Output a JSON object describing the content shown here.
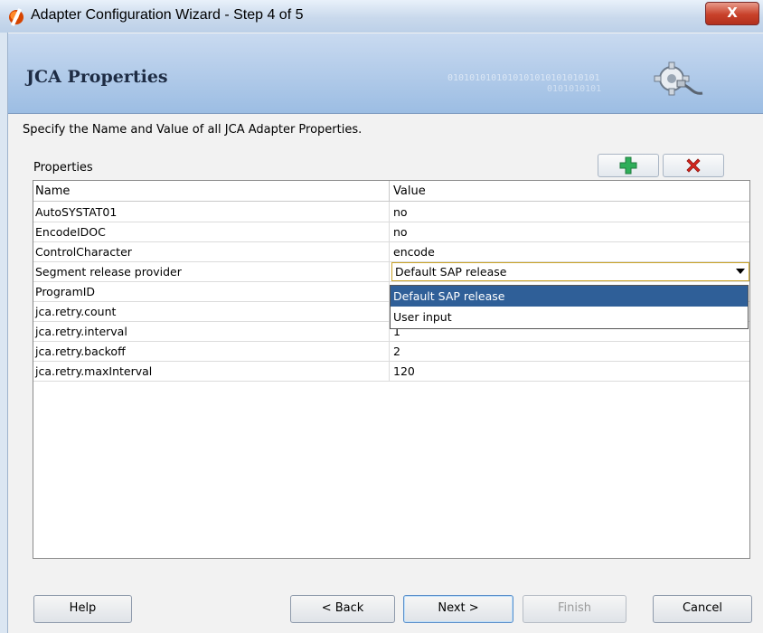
{
  "window": {
    "title": "Adapter Configuration Wizard - Step 4 of 5",
    "close_label": "X"
  },
  "header": {
    "title": "JCA Properties",
    "binary_line1": "0101010101010101010101010101",
    "binary_line2": "0101010101"
  },
  "instruction": "Specify the Name and Value of all JCA Adapter Properties.",
  "properties": {
    "label": "Properties",
    "columns": {
      "name": "Name",
      "value": "Value"
    },
    "rows": [
      {
        "name": "AutoSYSTAT01",
        "value": "no"
      },
      {
        "name": "EncodeIDOC",
        "value": "no"
      },
      {
        "name": "ControlCharacter",
        "value": "encode"
      },
      {
        "name": "Segment release provider",
        "value": "Default SAP release"
      },
      {
        "name": "ProgramID",
        "value": ""
      },
      {
        "name": "jca.retry.count",
        "value": ""
      },
      {
        "name": "jca.retry.interval",
        "value": "1"
      },
      {
        "name": "jca.retry.backoff",
        "value": "2"
      },
      {
        "name": "jca.retry.maxInterval",
        "value": "120"
      }
    ],
    "dropdown_options": [
      "Default SAP release",
      "User input"
    ],
    "selected_option": "Default SAP release"
  },
  "toolbar": {
    "add_icon": "plus-icon",
    "remove_icon": "x-icon",
    "add_color": "#2fae5a",
    "remove_color": "#d8241c"
  },
  "buttons": {
    "help": "Help",
    "back": "< Back",
    "next": "Next >",
    "finish": "Finish",
    "cancel": "Cancel"
  }
}
